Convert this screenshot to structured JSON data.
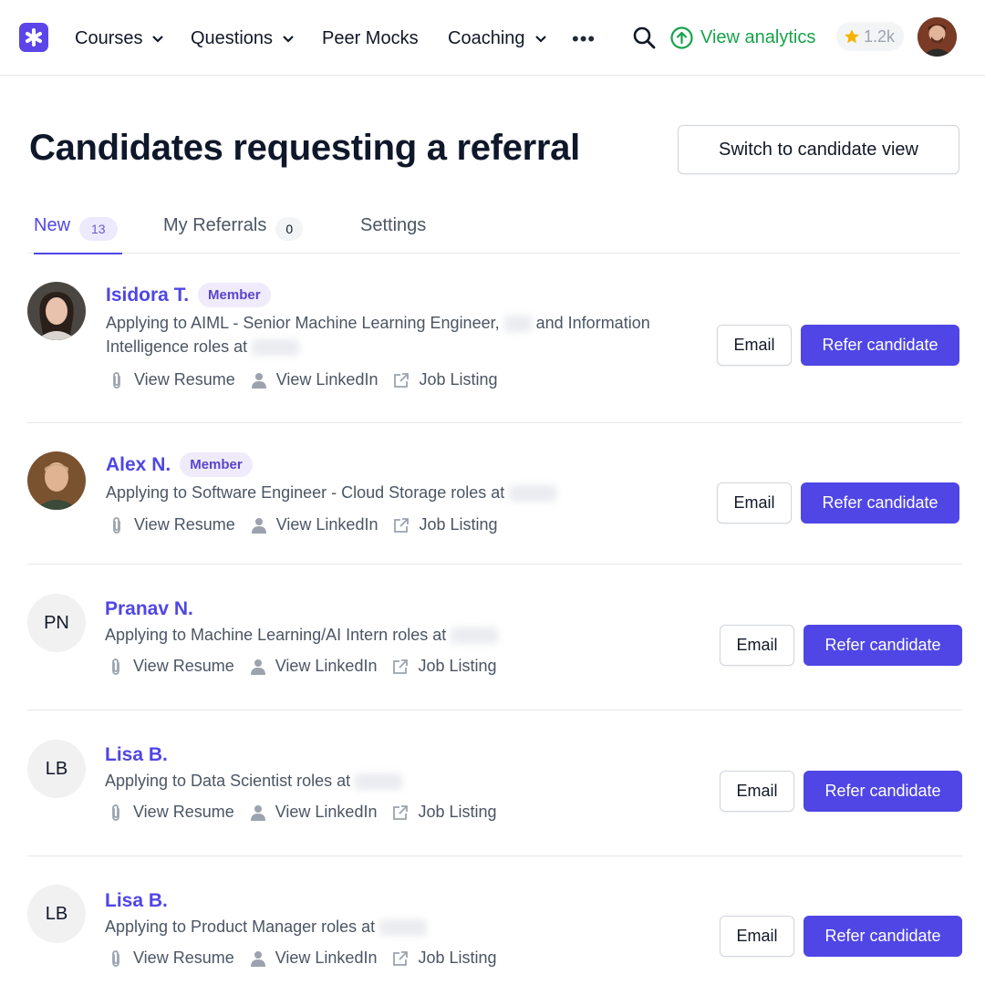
{
  "nav": {
    "items": [
      {
        "label": "Courses"
      },
      {
        "label": "Questions"
      },
      {
        "label": "Peer Mocks"
      },
      {
        "label": "Coaching"
      }
    ],
    "more_label": "•••",
    "analytics_label": "View analytics",
    "stars_count": "1.2k"
  },
  "header": {
    "title": "Candidates requesting a referral",
    "switch_label": "Switch to candidate view"
  },
  "tabs": [
    {
      "label": "New",
      "count": "13"
    },
    {
      "label": "My Referrals",
      "count": "0"
    },
    {
      "label": "Settings"
    }
  ],
  "colors": {
    "brand": "#5b45e8",
    "accent": "#4f46e5",
    "analytics": "#16a34a",
    "star": "#f5b301"
  },
  "candidates": [
    {
      "name": "Isidora T.",
      "badge": "Member",
      "avatar": "photo",
      "desc_1": "Applying to AIML - Senior Machine Learning Engineer,",
      "desc_2": "and Information",
      "desc_3": "Intelligence roles at"
    },
    {
      "name": "Alex N.",
      "badge": "Member",
      "avatar": "photo",
      "desc_1": "Applying to Software Engineer - Cloud Storage roles at"
    },
    {
      "name": "Pranav N.",
      "initials": "PN",
      "desc_1": "Applying to Machine Learning/AI Intern roles at"
    },
    {
      "name": "Lisa B.",
      "initials": "LB",
      "desc_1": "Applying to Data Scientist roles at"
    },
    {
      "name": "Lisa B.",
      "initials": "LB",
      "desc_1": "Applying to Product Manager roles at"
    }
  ],
  "actions": {
    "view_resume": "View Resume",
    "view_linkedin": "View LinkedIn",
    "job_listing": "Job Listing",
    "email": "Email",
    "refer": "Refer candidate"
  },
  "icons": {
    "logo": "asterisk-logo-icon",
    "search": "search-icon",
    "analytics": "arrow-up-circle-icon",
    "star": "star-icon",
    "resume": "paperclip-icon",
    "linkedin": "person-icon",
    "job": "external-link-icon"
  }
}
